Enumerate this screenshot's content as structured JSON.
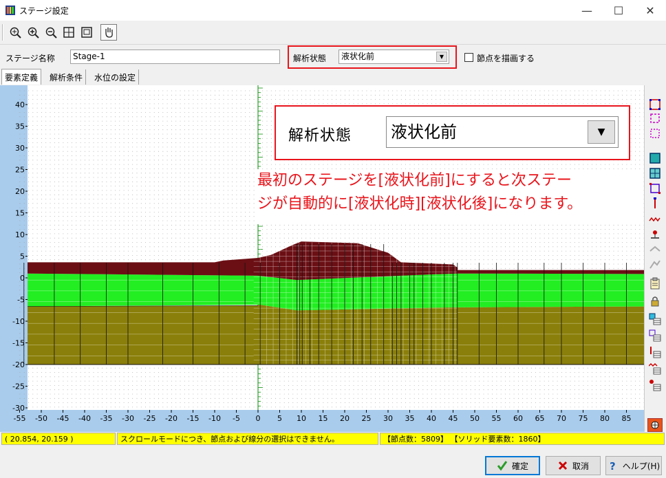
{
  "window": {
    "title": "ステージ設定"
  },
  "toolbar": {
    "icons": [
      "zoom-fit-icon",
      "zoom-in-icon",
      "zoom-out-icon",
      "zoom-all-icon",
      "zoom-window-icon",
      "hand-pan-icon"
    ]
  },
  "stage": {
    "name_label": "ステージ名称",
    "name_value": "Stage-1"
  },
  "analysis": {
    "label": "解析状態",
    "selected": "液状化前",
    "draw_nodes_label": "節点を描画する"
  },
  "tabs": [
    {
      "label": "要素定義"
    },
    {
      "label": "解析条件"
    },
    {
      "label": "水位の設定"
    }
  ],
  "callout": {
    "label": "解析状態",
    "selected": "液状化前"
  },
  "note": {
    "line1": "最初のステージを[液状化前]にすると次ステー",
    "line2": "ジが自動的に[液状化時][液状化後]になります。"
  },
  "axes": {
    "x_ticks": [
      "-55",
      "-50",
      "-45",
      "-40",
      "-35",
      "-30",
      "-25",
      "-20",
      "-15",
      "-10",
      "-5",
      "0",
      "5",
      "10",
      "15",
      "20",
      "25",
      "30",
      "35",
      "40",
      "45",
      "50",
      "55",
      "60",
      "65",
      "70",
      "75",
      "80",
      "85"
    ],
    "y_ticks": [
      "40",
      "35",
      "30",
      "25",
      "20",
      "15",
      "10",
      "5",
      "0",
      "-5",
      "-10",
      "-15",
      "-20",
      "-25",
      "-30"
    ]
  },
  "status": {
    "coords": "(  20.854,   20.159 )",
    "message": "スクロールモードにつき、節点および線分の選択はできません。",
    "counts": "【節点数：5809】 【ソリッド要素数：1860】"
  },
  "buttons": {
    "ok": "確定",
    "cancel": "取消",
    "help": "ヘルプ(H)"
  },
  "colors": {
    "embankment": "#6b0f14",
    "upper_layer": "#22ee22",
    "lower_layer": "#8a7f0a",
    "highlight": "#e8141b",
    "status": "#ffff00"
  }
}
